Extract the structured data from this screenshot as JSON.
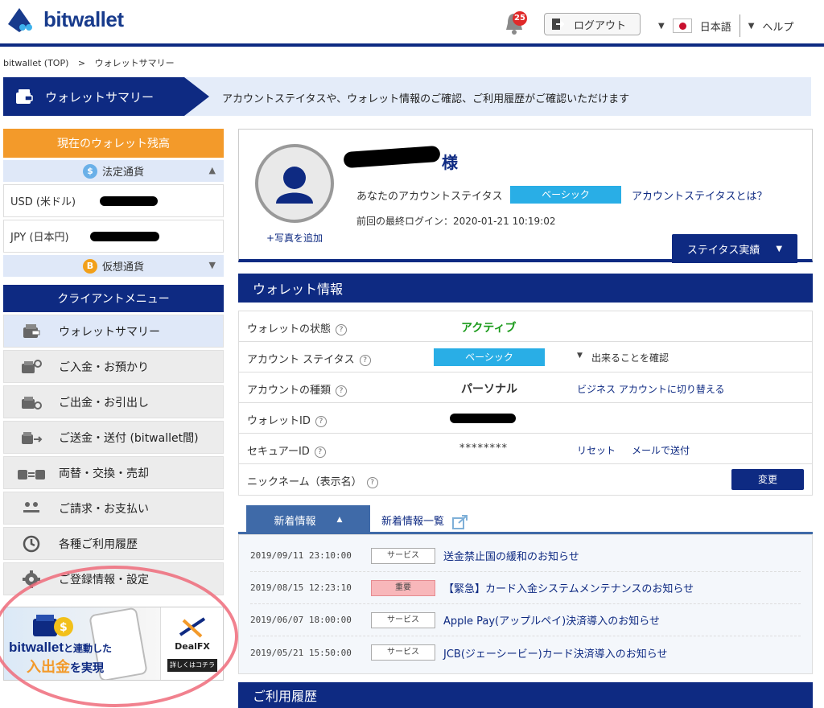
{
  "header": {
    "logo_text": "bitwallet",
    "notification_count": "25",
    "logout_label": "ログアウト",
    "language": "日本語",
    "help": "ヘルプ"
  },
  "breadcrumb": {
    "home": "bitwallet (TOP)",
    "separator": ">",
    "current": "ウォレットサマリー"
  },
  "summary_bar": {
    "title": "ウォレットサマリー",
    "description": "アカウントステイタスや、ウォレット情報のご確認、ご利用履歴がご確認いただけます"
  },
  "sidebar": {
    "balance_header": "現在のウォレット残高",
    "fiat_label": "法定通貨",
    "balances": [
      {
        "label": "USD (米ドル)"
      },
      {
        "label": "JPY (日本円)"
      }
    ],
    "crypto_label": "仮想通貨",
    "menu_header": "クライアントメニュー",
    "menu_items": [
      {
        "label": "ウォレットサマリー",
        "icon": "wallet-icon"
      },
      {
        "label": "ご入金・お預かり",
        "icon": "deposit-icon"
      },
      {
        "label": "ご出金・お引出し",
        "icon": "withdraw-icon"
      },
      {
        "label": "ご送金・送付 (bitwallet間)",
        "icon": "transfer-icon"
      },
      {
        "label": "両替・交換・売却",
        "icon": "exchange-icon"
      },
      {
        "label": "ご請求・お支払い",
        "icon": "payment-icon"
      },
      {
        "label": "各種ご利用履歴",
        "icon": "history-icon"
      },
      {
        "label": "ご登録情報・設定",
        "icon": "gear-icon"
      }
    ],
    "banner": {
      "line1_brand": "bitwallet",
      "line1_rest": "と連動した",
      "line2_highlight": "入出金",
      "line2_rest": "を実現",
      "partner": "DealFX",
      "button": "詳しくはコチラ"
    }
  },
  "profile": {
    "honorific": "様",
    "add_photo": "+写真を追加",
    "status_label": "あなたのアカウントステイタス",
    "status_value": "ベーシック",
    "status_link": "アカウントステイタスとは？",
    "last_login_label": "前回の最終ログイン：",
    "last_login_value": "2020-01-21 10:19:02",
    "status_button": "ステイタス実績"
  },
  "wallet_info": {
    "title": "ウォレット情報",
    "rows": {
      "state_label": "ウォレットの状態",
      "state_value": "アクティブ",
      "account_status_label": "アカウント ステイタス",
      "account_status_value": "ベーシック",
      "account_status_link": "出来ることを確認",
      "account_type_label": "アカウントの種類",
      "account_type_value": "パーソナル",
      "account_type_link": "ビジネス アカウントに切り替える",
      "wallet_id_label": "ウォレットID",
      "secure_id_label": "セキュアーID",
      "secure_id_value": "********",
      "secure_id_reset": "リセット",
      "secure_id_mail": "メールで送付",
      "nickname_label": "ニックネーム（表示名）",
      "nickname_button": "変更"
    }
  },
  "news": {
    "tab_label": "新着情報",
    "list_link": "新着情報一覧",
    "items": [
      {
        "date": "2019/09/11 23:10:00",
        "badge": "サービス",
        "title": "送金禁止国の緩和のお知らせ",
        "urgent": false
      },
      {
        "date": "2019/08/15 12:23:10",
        "badge": "重要",
        "title": "【緊急】カード入金システムメンテナンスのお知らせ",
        "urgent": true
      },
      {
        "date": "2019/06/07 18:00:00",
        "badge": "サービス",
        "title": "Apple Pay(アップルペイ)決済導入のお知らせ",
        "urgent": false
      },
      {
        "date": "2019/05/21 15:50:00",
        "badge": "サービス",
        "title": "JCB(ジェーシービー)カード決済導入のお知らせ",
        "urgent": false
      }
    ]
  },
  "usage": {
    "title": "ご利用履歴"
  },
  "colors": {
    "brand_navy": "#0e2a82",
    "accent_orange": "#f39a2a",
    "status_cyan": "#29aee6",
    "active_green": "#1a9a1a",
    "urgent_pink": "#f8b7ba",
    "highlight_circle": "#ef6b7a"
  }
}
